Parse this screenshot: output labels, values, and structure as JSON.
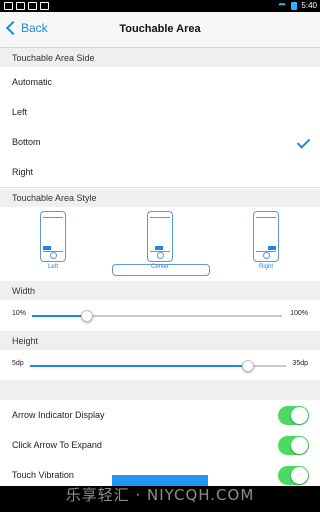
{
  "status_bar": {
    "time": "5:40"
  },
  "nav": {
    "back_label": "Back",
    "title": "Touchable Area"
  },
  "side_section": {
    "header": "Touchable Area Side",
    "options": [
      "Automatic",
      "Left",
      "Bottom",
      "Right"
    ],
    "selected": "Bottom"
  },
  "style_section": {
    "header": "Touchable Area Style",
    "options": [
      "Left",
      "Center",
      "Right"
    ],
    "selected": "Center"
  },
  "width_section": {
    "header": "Width",
    "min_label": "10%",
    "max_label": "100%",
    "fraction": 0.22
  },
  "height_section": {
    "header": "Height",
    "min_label": "5dp",
    "max_label": "35dp",
    "fraction": 0.85
  },
  "toggles": [
    {
      "label": "Arrow Indicator Display",
      "on": true
    },
    {
      "label": "Click Arrow To Expand",
      "on": true
    },
    {
      "label": "Touch Vibration",
      "on": true
    }
  ],
  "colors": {
    "accent": "#1e88e5",
    "toggle_on": "#4cd964",
    "section_bg": "#efefef"
  },
  "watermark": "乐享轻汇 · NIYCQH.COM"
}
